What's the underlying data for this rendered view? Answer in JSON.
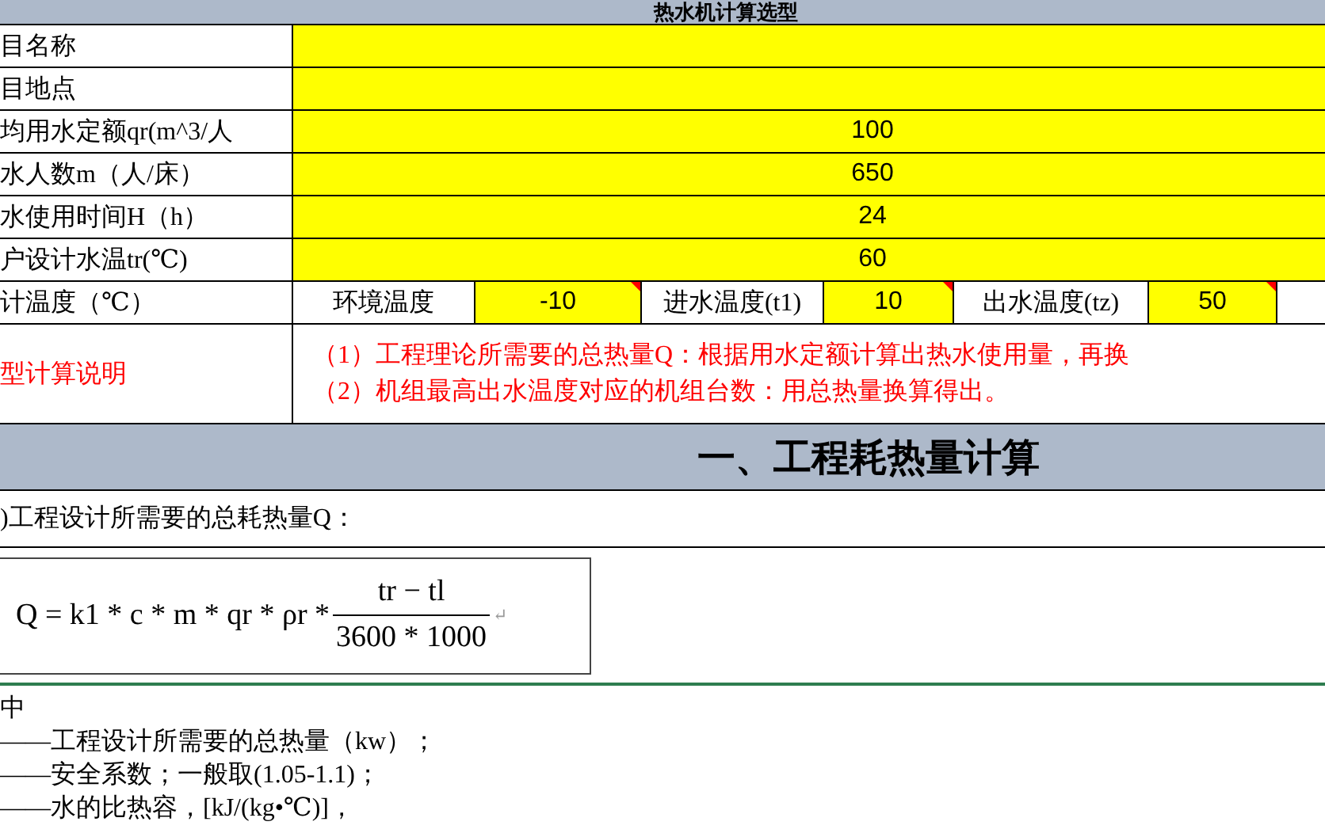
{
  "title": "热水机计算选型",
  "fields": [
    {
      "label": "目名称"
    },
    {
      "label": "目地点"
    },
    {
      "label": "均用水定额qr(m^3/人",
      "value": "100"
    },
    {
      "label": "水人数m（人/床）",
      "value": "650"
    },
    {
      "label": "水使用时间H（h）",
      "value": "24"
    },
    {
      "label": "户设计水温tr(℃)",
      "value": "60"
    }
  ],
  "temperature_row": {
    "label": "计温度（℃）",
    "cells": [
      {
        "kind": "label",
        "text": "环境温度"
      },
      {
        "kind": "value",
        "text": "-10",
        "commented": true
      },
      {
        "kind": "label",
        "text": "进水温度(t1)"
      },
      {
        "kind": "value",
        "text": "10",
        "commented": true
      },
      {
        "kind": "label",
        "text": "出水温度(tz)"
      },
      {
        "kind": "value",
        "text": "50",
        "commented": true
      }
    ]
  },
  "description": {
    "label": "型计算说明",
    "lines": [
      "（1）工程理论所需要的总热量Q：根据用水定额计算出热水使用量，再换",
      "（2）机组最高出水温度对应的机组台数：用总热量换算得出。"
    ]
  },
  "section": {
    "title": "一、工程耗热量计算"
  },
  "subheading": ")工程设计所需要的总耗热量Q：",
  "formula": {
    "lhs": "Q = k1 * c * m * qr * ρr *",
    "numerator": "tr − tl",
    "denominator": "3600 * 1000",
    "mark": "↵"
  },
  "notes": [
    "中",
    "——工程设计所需要的总热量（kw）；",
    "——安全系数；一般取(1.05-1.1)；",
    "——水的比热容，[kJ/(kg•℃)]，"
  ]
}
